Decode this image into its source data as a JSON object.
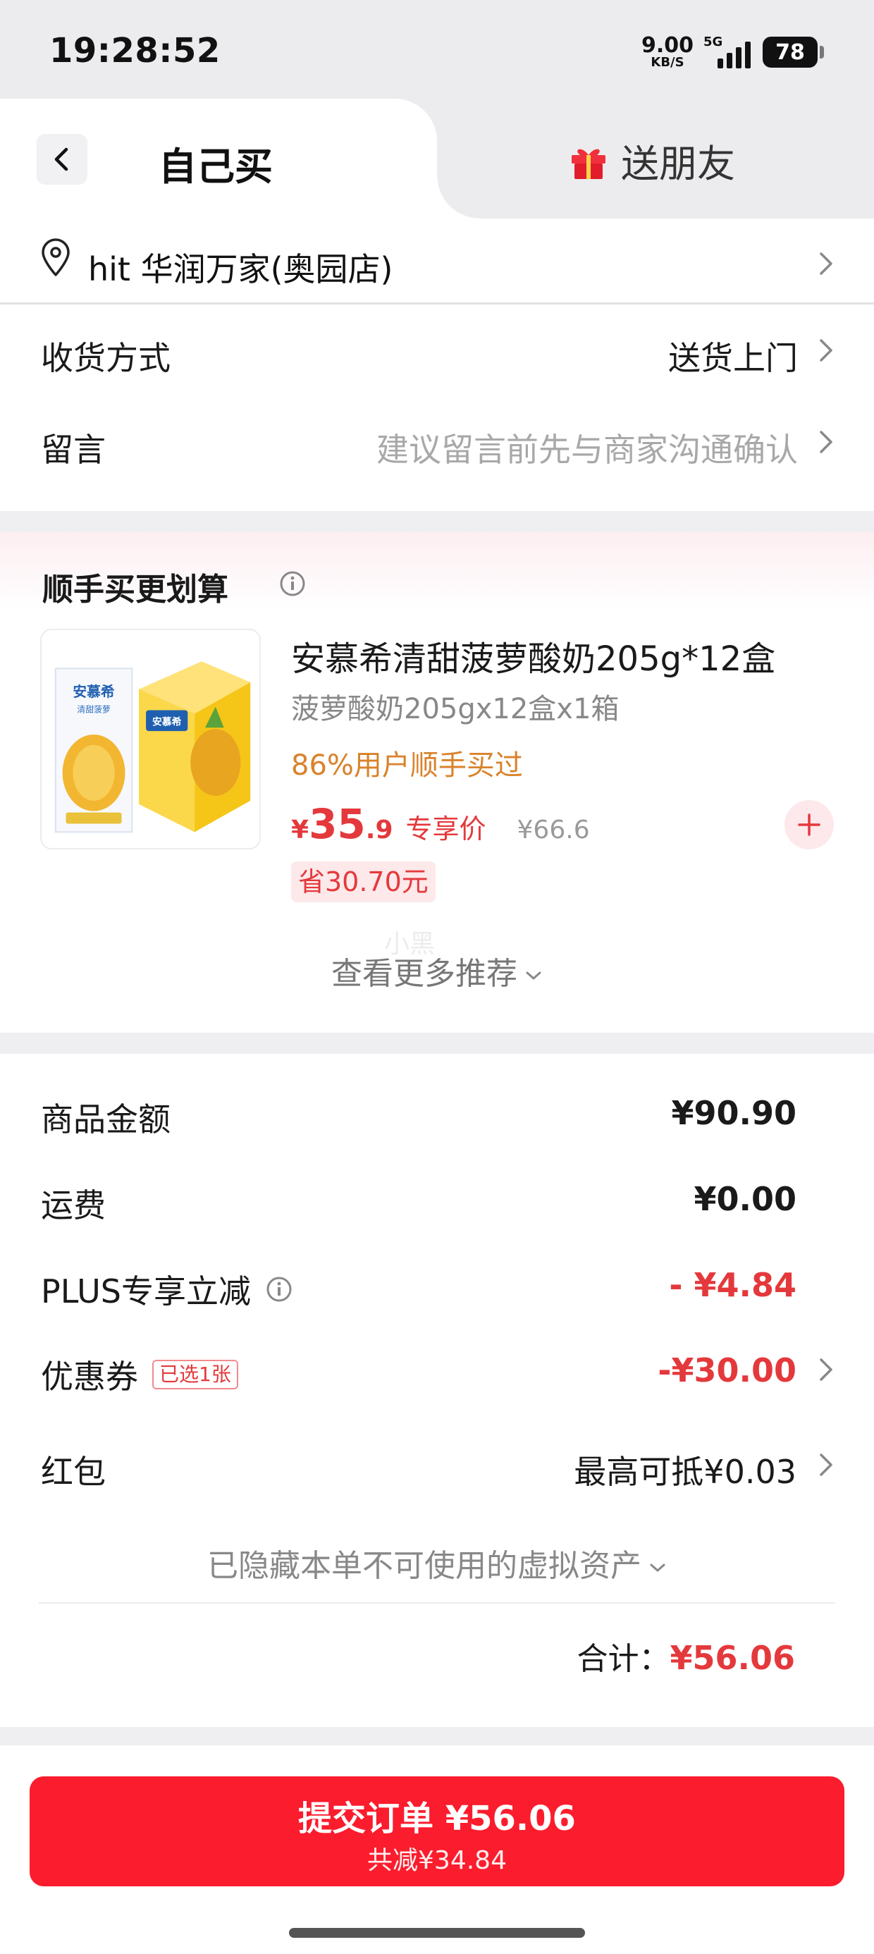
{
  "status_bar": {
    "time": "19:28:52",
    "net_speed_value": "9.00",
    "net_speed_unit": "KB/S",
    "network": "5G",
    "battery": "78"
  },
  "tabs": {
    "self_buy": "自己买",
    "gift": "送朋友"
  },
  "address": {
    "text": "hit  华润万家(奥园店)"
  },
  "delivery": {
    "label": "收货方式",
    "value": "送货上门"
  },
  "message": {
    "label": "留言",
    "placeholder": "建议留言前先与商家沟通确认"
  },
  "recommendation": {
    "title": "顺手买更划算",
    "product": {
      "name": "安慕希清甜菠萝酸奶205g*12盒",
      "spec": "菠萝酸奶205gx12盒x1箱",
      "social_proof": "86%用户顺手买过",
      "price_symbol": "¥",
      "price_integer": "35",
      "price_decimal": ".9",
      "price_tag": "专享价",
      "original_price": "¥66.6",
      "savings": "省30.70元",
      "box_brand": "安慕希",
      "box_flavor": "清甜菠萝"
    },
    "watermark": "小黑",
    "see_more": "查看更多推荐"
  },
  "summary": {
    "goods_amount": {
      "label": "商品金额",
      "value": "¥90.90"
    },
    "shipping": {
      "label": "运费",
      "value": "¥0.00"
    },
    "plus_discount": {
      "label": "PLUS专享立减",
      "value": "- ¥4.84"
    },
    "coupon": {
      "label": "优惠券",
      "badge": "已选1张",
      "value": "-¥30.00"
    },
    "red_packet": {
      "label": "红包",
      "value": "最高可抵¥0.03"
    },
    "hidden_assets": "已隐藏本单不可使用的虚拟资产",
    "total_label": "合计：",
    "total_value": "¥56.06"
  },
  "submit": {
    "label": "提交订单 ¥56.06",
    "savings": "共减¥34.84"
  },
  "colors": {
    "accent_red": "#e4393c",
    "submit_red": "#fb1c2d",
    "social_orange": "#d9822b"
  }
}
